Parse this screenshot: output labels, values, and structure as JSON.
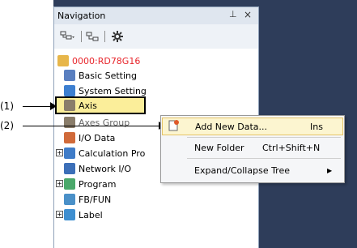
{
  "navigation": {
    "title": "Navigation",
    "pin_glyph": "⊥",
    "close_glyph": "×"
  },
  "toolbar": {
    "buttons": [
      "tree-view-icon",
      "collapse-icon",
      "gear-icon"
    ]
  },
  "tree": {
    "root_label": "0000:RD78G16",
    "items": [
      {
        "label": "Basic Setting",
        "icon": "settings-icon"
      },
      {
        "label": "System Setting",
        "icon": "system-icon"
      },
      {
        "label": "Axis",
        "icon": "axis-icon"
      },
      {
        "label": "Axes Group",
        "icon": "axes-group-icon"
      },
      {
        "label": "I/O Data",
        "icon": "io-icon"
      },
      {
        "label": "Calculation Pro",
        "icon": "calc-icon"
      },
      {
        "label": "Network I/O",
        "icon": "network-icon"
      },
      {
        "label": "Program",
        "icon": "program-icon"
      },
      {
        "label": "FB/FUN",
        "icon": "fb-icon"
      },
      {
        "label": "Label",
        "icon": "label-icon"
      }
    ]
  },
  "callouts": {
    "c1": "(1)",
    "c2": "(2)"
  },
  "context_menu": {
    "items": [
      {
        "label": "Add New Data...",
        "shortcut": "Ins"
      },
      {
        "label": "New Folder",
        "shortcut": "Ctrl+Shift+N"
      },
      {
        "label": "Expand/Collapse Tree",
        "shortcut": "▶"
      }
    ]
  },
  "colors": {
    "root_label": "#e8262c",
    "selected_bg": "#fbee9a",
    "dark_bg": "#2e3d5a"
  }
}
